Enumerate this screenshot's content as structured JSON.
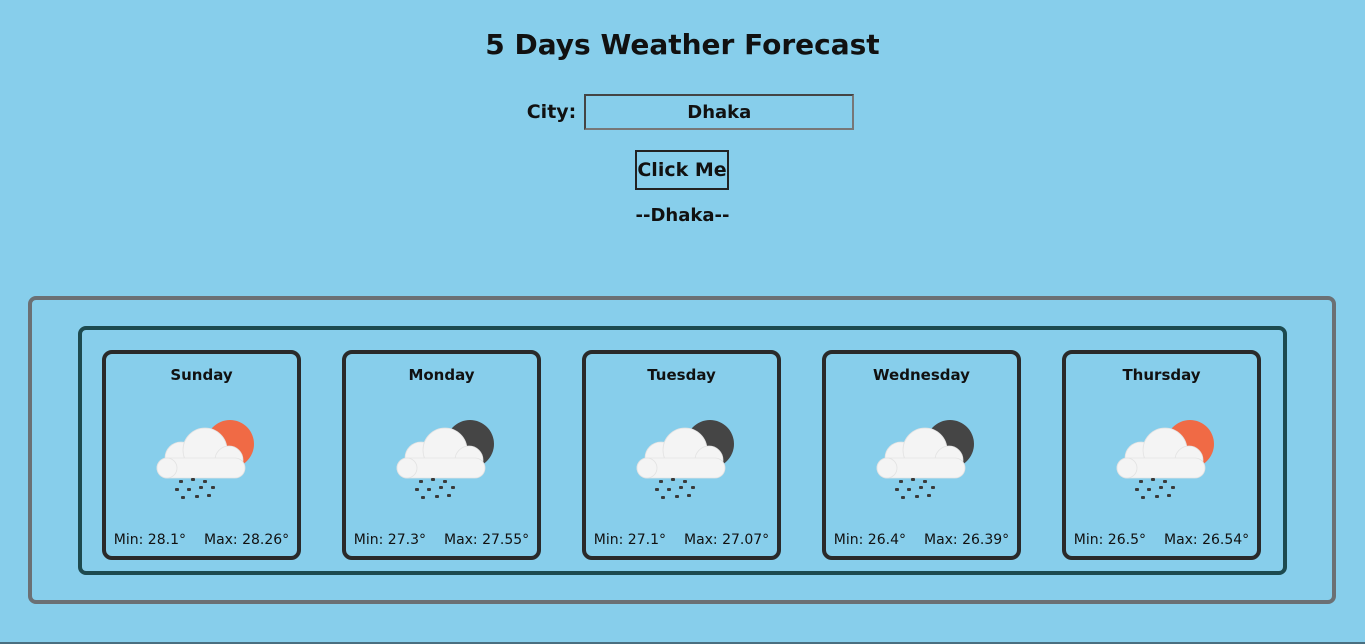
{
  "header": {
    "title": "5 Days Weather Forecast"
  },
  "search": {
    "label": "City:",
    "value": "Dhaka",
    "button_label": "Click Me"
  },
  "result": {
    "city_display": "--Dhaka--"
  },
  "colors": {
    "background": "#87ceeb",
    "sun": "#f06a45",
    "moon": "#454545",
    "cloud": "#f4f4f4"
  },
  "forecast": [
    {
      "day": "Sunday",
      "icon": "cloud-sun-snow-icon",
      "min": "Min: 28.1°",
      "max": "Max: 28.26°"
    },
    {
      "day": "Monday",
      "icon": "cloud-moon-snow-icon",
      "min": "Min: 27.3°",
      "max": "Max: 27.55°"
    },
    {
      "day": "Tuesday",
      "icon": "cloud-moon-snow-icon",
      "min": "Min: 27.1°",
      "max": "Max: 27.07°"
    },
    {
      "day": "Wednesday",
      "icon": "cloud-moon-snow-icon",
      "min": "Min: 26.4°",
      "max": "Max: 26.39°"
    },
    {
      "day": "Thursday",
      "icon": "cloud-sun-snow-icon",
      "min": "Min: 26.5°",
      "max": "Max: 26.54°"
    }
  ]
}
